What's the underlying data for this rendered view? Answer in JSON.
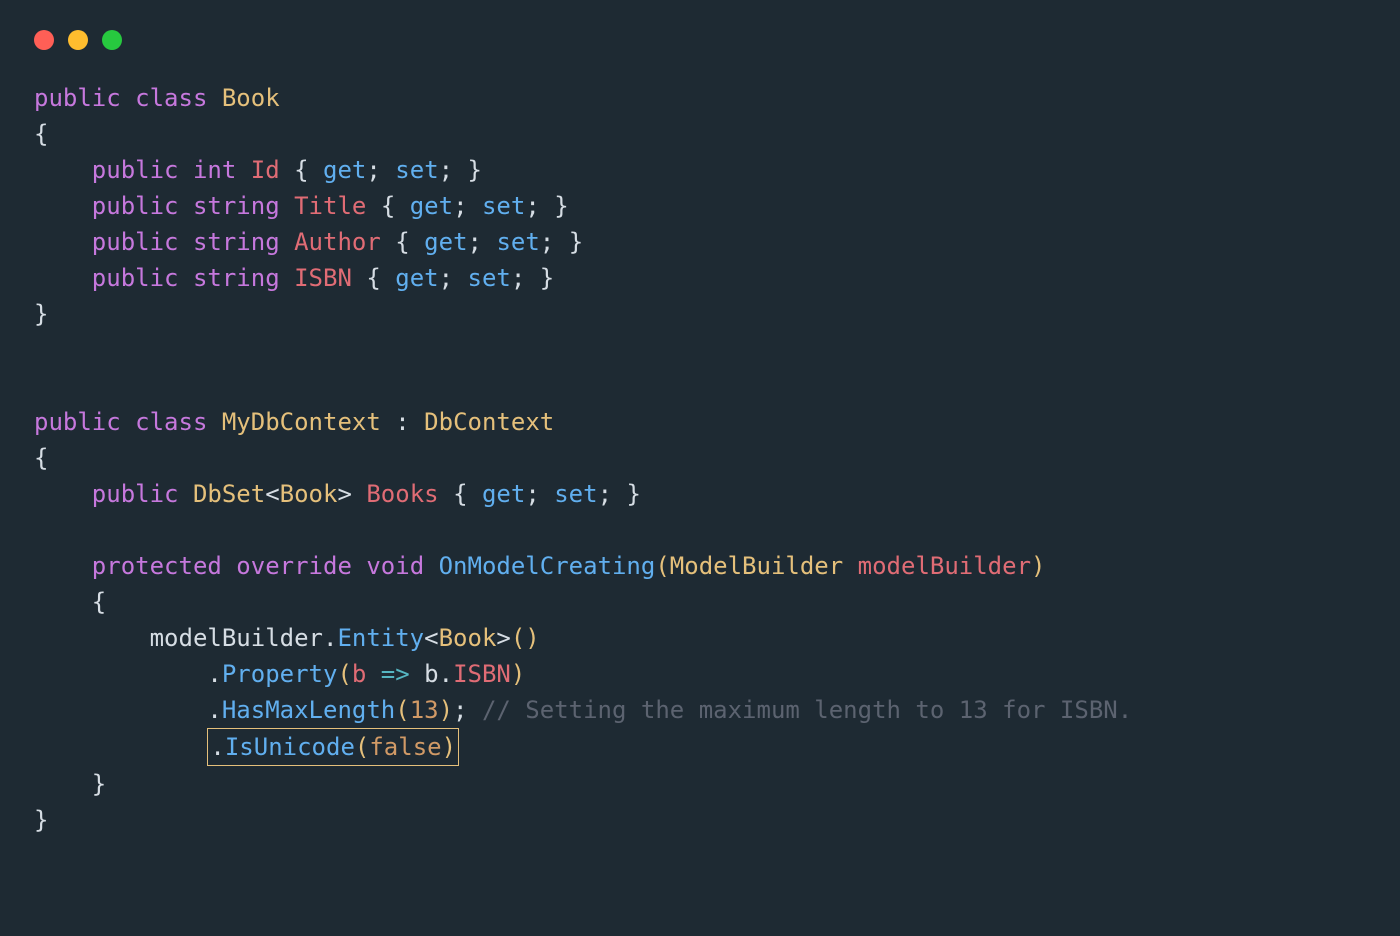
{
  "tokens": {
    "public": "public",
    "class": "class",
    "protected": "protected",
    "override": "override",
    "void": "void",
    "int": "int",
    "string": "string",
    "false": "false",
    "num13": "13",
    "Book": "Book",
    "MyDbContext": "MyDbContext",
    "DbContext": "DbContext",
    "DbSet": "DbSet",
    "ModelBuilder": "ModelBuilder",
    "Id": "Id",
    "Title": "Title",
    "Author": "Author",
    "ISBN": "ISBN",
    "Books": "Books",
    "modelBuilder": "modelBuilder",
    "b": "b",
    "OnModelCreating": "OnModelCreating",
    "Entity": "Entity",
    "Property": "Property",
    "HasMaxLength": "HasMaxLength",
    "IsUnicode": "IsUnicode",
    "get": "get",
    "set": "set",
    "comment1": "// Setting the maximum length to 13 for ISBN."
  },
  "colors": {
    "background": "#1e2a33",
    "keyword": "#c678dd",
    "class": "#e5c07b",
    "method": "#61afef",
    "property": "#e06c75",
    "text": "#d6dde4",
    "number": "#d19a66",
    "comment": "#5c6370",
    "operator": "#56b6c2"
  },
  "highlight": ".IsUnicode(false)"
}
